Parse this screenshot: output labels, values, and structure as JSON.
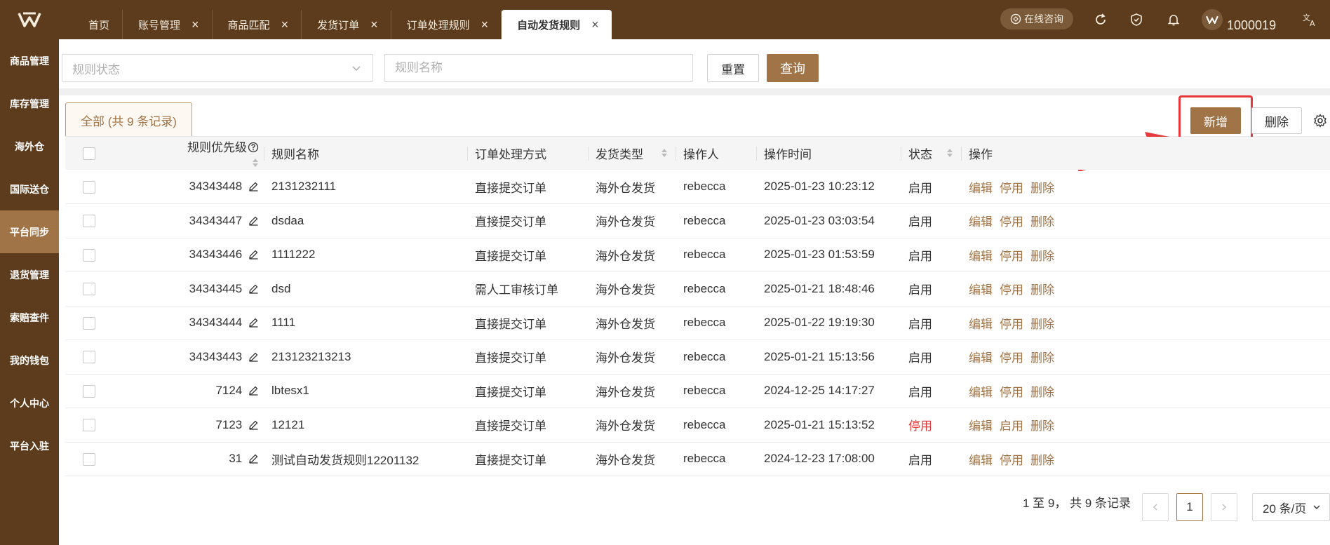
{
  "header": {
    "tabs": [
      {
        "label": "首页",
        "closable": false
      },
      {
        "label": "账号管理",
        "closable": true
      },
      {
        "label": "商品匹配",
        "closable": true
      },
      {
        "label": "发货订单",
        "closable": true
      },
      {
        "label": "订单处理规则",
        "closable": true
      },
      {
        "label": "自动发货规则",
        "closable": true,
        "active": true
      }
    ],
    "consult_label": "在线咨询",
    "user_id": "1000019"
  },
  "sidebar": {
    "items": [
      "商品管理",
      "库存管理",
      "海外仓",
      "国际送仓",
      "平台同步",
      "退货管理",
      "索赔查件",
      "我的钱包",
      "个人中心",
      "平台入驻"
    ],
    "active_index": 4
  },
  "filters": {
    "status_placeholder": "规则状态",
    "name_placeholder": "规则名称",
    "reset_label": "重置",
    "query_label": "查询"
  },
  "toolbar": {
    "all_tab_label": "全部 (共 9 条记录)",
    "add_label": "新增",
    "delete_label": "删除"
  },
  "table": {
    "columns": [
      "规则优先级",
      "规则名称",
      "订单处理方式",
      "发货类型",
      "操作人",
      "操作时间",
      "状态",
      "操作"
    ],
    "rows": [
      {
        "priority": "34343448",
        "name": "2131232111",
        "method": "直接提交订单",
        "type": "海外仓发货",
        "operator": "rebecca",
        "time": "2025-01-23 10:23:12",
        "status": "启用",
        "toggle": "停用"
      },
      {
        "priority": "34343447",
        "name": "dsdaa",
        "method": "直接提交订单",
        "type": "海外仓发货",
        "operator": "rebecca",
        "time": "2025-01-23 03:03:54",
        "status": "启用",
        "toggle": "停用"
      },
      {
        "priority": "34343446",
        "name": "1111222",
        "method": "直接提交订单",
        "type": "海外仓发货",
        "operator": "rebecca",
        "time": "2025-01-23 01:53:59",
        "status": "启用",
        "toggle": "停用"
      },
      {
        "priority": "34343445",
        "name": "dsd",
        "method": "需人工审核订单",
        "type": "海外仓发货",
        "operator": "rebecca",
        "time": "2025-01-21 18:48:46",
        "status": "启用",
        "toggle": "停用"
      },
      {
        "priority": "34343444",
        "name": "1111",
        "method": "直接提交订单",
        "type": "海外仓发货",
        "operator": "rebecca",
        "time": "2025-01-22 19:19:30",
        "status": "启用",
        "toggle": "停用"
      },
      {
        "priority": "34343443",
        "name": "213123213213",
        "method": "直接提交订单",
        "type": "海外仓发货",
        "operator": "rebecca",
        "time": "2025-01-21 15:13:56",
        "status": "启用",
        "toggle": "停用"
      },
      {
        "priority": "7124",
        "name": "lbtesx1",
        "method": "直接提交订单",
        "type": "海外仓发货",
        "operator": "rebecca",
        "time": "2024-12-25 14:17:27",
        "status": "启用",
        "toggle": "停用"
      },
      {
        "priority": "7123",
        "name": "12121",
        "method": "直接提交订单",
        "type": "海外仓发货",
        "operator": "rebecca",
        "time": "2025-01-21 15:13:52",
        "status": "停用",
        "toggle": "启用"
      },
      {
        "priority": "31",
        "name": "测试自动发货规则12201132",
        "method": "直接提交订单",
        "type": "海外仓发货",
        "operator": "rebecca",
        "time": "2024-12-23 17:08:00",
        "status": "启用",
        "toggle": "停用"
      }
    ],
    "edit_label": "编辑",
    "delete_label": "删除"
  },
  "pagination": {
    "summary": "1 至 9， 共 9 条记录",
    "current_page": "1",
    "page_size": "20 条/页"
  },
  "colors": {
    "brand_dark": "#5c3c1c",
    "accent": "#a07447",
    "highlight": "#e5393b",
    "stopped": "#e4393c"
  }
}
